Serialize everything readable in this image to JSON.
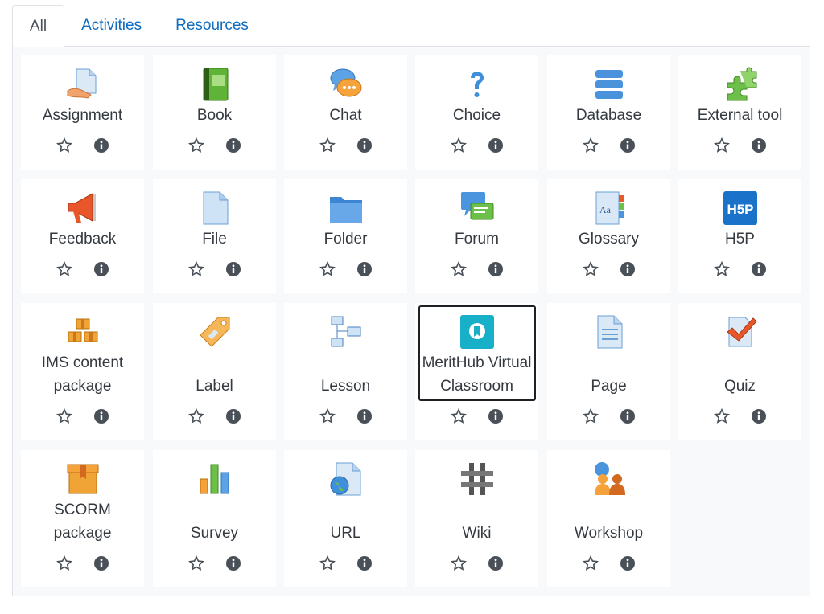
{
  "tabs": [
    {
      "label": "All",
      "active": true
    },
    {
      "label": "Activities",
      "active": false
    },
    {
      "label": "Resources",
      "active": false
    }
  ],
  "modules": [
    {
      "name": "Assignment",
      "icon": "assignment-icon"
    },
    {
      "name": "Book",
      "icon": "book-icon"
    },
    {
      "name": "Chat",
      "icon": "chat-icon"
    },
    {
      "name": "Choice",
      "icon": "choice-icon"
    },
    {
      "name": "Database",
      "icon": "database-icon"
    },
    {
      "name": "External tool",
      "icon": "external-tool-icon"
    },
    {
      "name": "Feedback",
      "icon": "feedback-icon"
    },
    {
      "name": "File",
      "icon": "file-icon"
    },
    {
      "name": "Folder",
      "icon": "folder-icon"
    },
    {
      "name": "Forum",
      "icon": "forum-icon"
    },
    {
      "name": "Glossary",
      "icon": "glossary-icon"
    },
    {
      "name": "H5P",
      "icon": "h5p-icon"
    },
    {
      "name": "IMS content package",
      "icon": "ims-content-package-icon"
    },
    {
      "name": "Label",
      "icon": "label-icon"
    },
    {
      "name": "Lesson",
      "icon": "lesson-icon"
    },
    {
      "name": "MeritHub Virtual Classroom",
      "icon": "merithub-icon",
      "selected": true
    },
    {
      "name": "Page",
      "icon": "page-icon"
    },
    {
      "name": "Quiz",
      "icon": "quiz-icon"
    },
    {
      "name": "SCORM package",
      "icon": "scorm-package-icon"
    },
    {
      "name": "Survey",
      "icon": "survey-icon"
    },
    {
      "name": "URL",
      "icon": "url-icon"
    },
    {
      "name": "Wiki",
      "icon": "wiki-icon"
    },
    {
      "name": "Workshop",
      "icon": "workshop-icon"
    }
  ],
  "h5p_icon_text": "H5P",
  "colors": {
    "link": "#0f6cbf",
    "panel_bg": "#f8f9fa",
    "border": "#dee2e6",
    "text": "#343a40",
    "action_icon": "#495057"
  }
}
